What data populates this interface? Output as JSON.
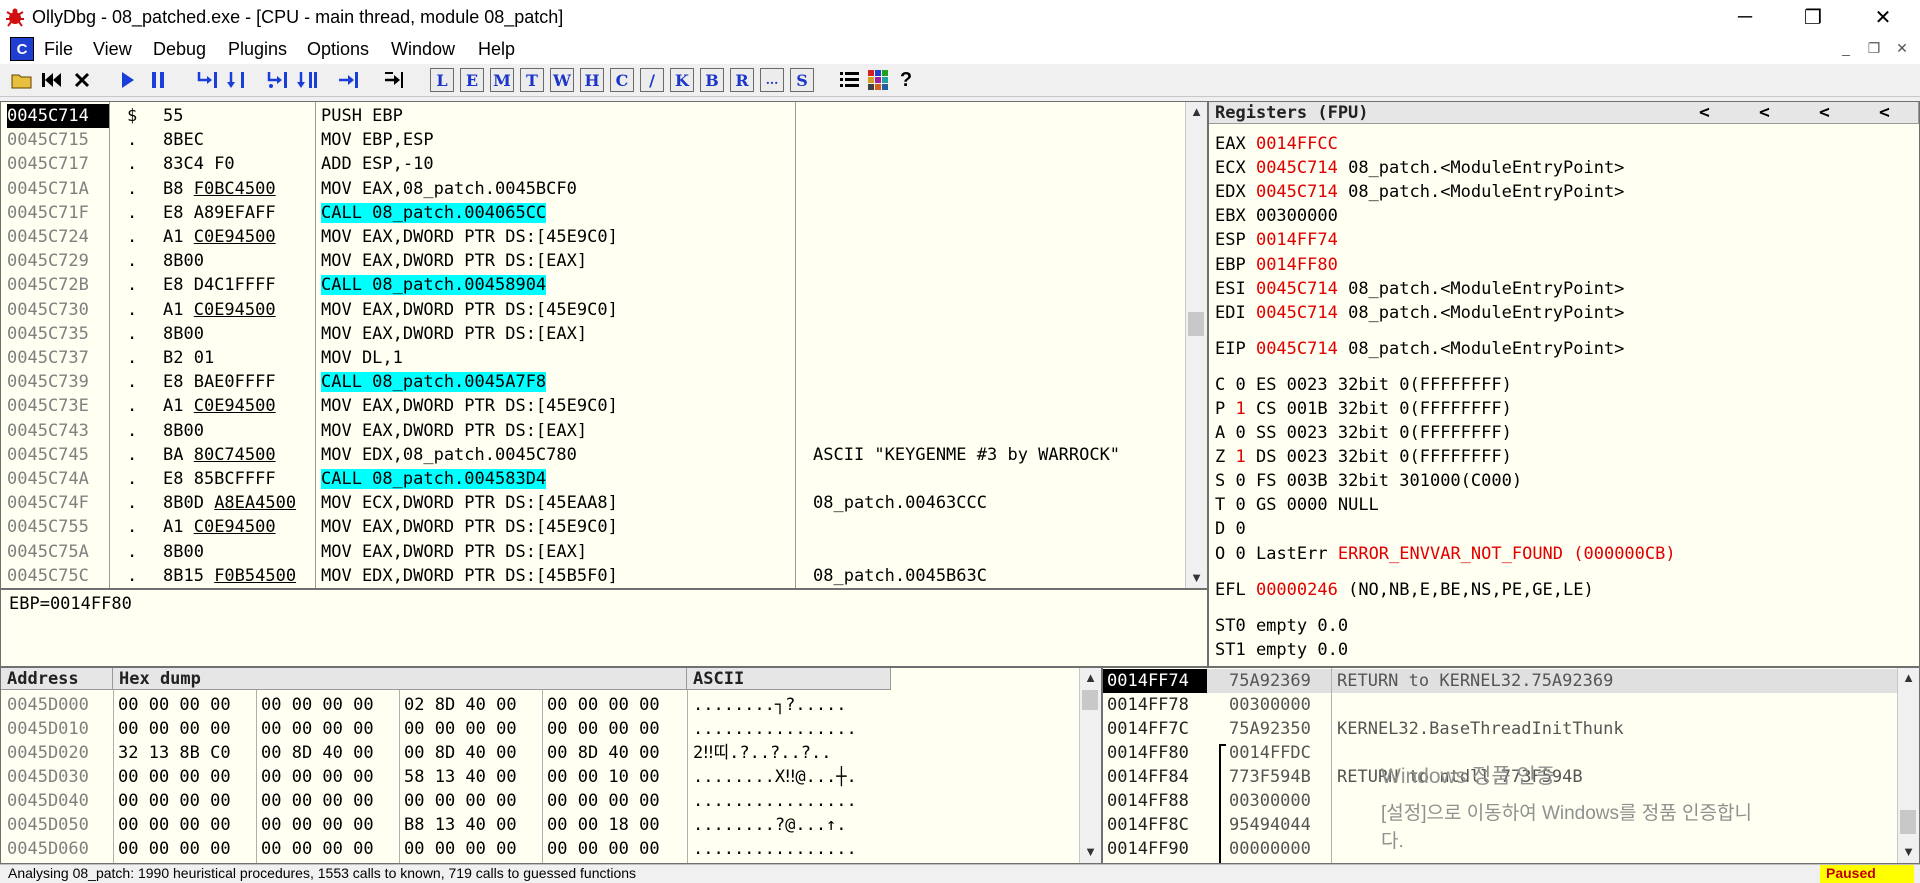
{
  "window": {
    "title": "OllyDbg - 08_patched.exe - [CPU - main thread, module 08_patch]",
    "controls": [
      "─",
      "❐",
      "✕"
    ]
  },
  "menu": {
    "icon_label": "C",
    "items": [
      "File",
      "View",
      "Debug",
      "Plugins",
      "Options",
      "Window",
      "Help"
    ],
    "mdi_controls": [
      "_",
      "❐",
      "✕"
    ]
  },
  "toolbar": {
    "letters": [
      "L",
      "E",
      "M",
      "T",
      "W",
      "H",
      "C",
      "/",
      "K",
      "B",
      "R",
      "...",
      "S"
    ]
  },
  "cpu": {
    "rows": [
      {
        "addr": "0045C714",
        "mark": "$",
        "hex": "55",
        "hex_ul": "",
        "dis": "PUSH EBP",
        "call": false,
        "comment": "",
        "selected": true
      },
      {
        "addr": "0045C715",
        "mark": ".",
        "hex": "8BEC",
        "hex_ul": "",
        "dis": "MOV EBP,ESP",
        "call": false,
        "comment": ""
      },
      {
        "addr": "0045C717",
        "mark": ".",
        "hex": "83C4 F0",
        "hex_ul": "",
        "dis": "ADD ESP,-10",
        "call": false,
        "comment": ""
      },
      {
        "addr": "0045C71A",
        "mark": ".",
        "hex": "B8 ",
        "hex_ul": "F0BC4500",
        "dis": "MOV EAX,08_patch.0045BCF0",
        "call": false,
        "comment": ""
      },
      {
        "addr": "0045C71F",
        "mark": ".",
        "hex": "E8 A89EFAFF",
        "hex_ul": "",
        "dis": "CALL 08_patch.004065CC",
        "call": true,
        "comment": ""
      },
      {
        "addr": "0045C724",
        "mark": ".",
        "hex": "A1 ",
        "hex_ul": "C0E94500",
        "dis": "MOV EAX,DWORD PTR DS:[45E9C0]",
        "call": false,
        "comment": ""
      },
      {
        "addr": "0045C729",
        "mark": ".",
        "hex": "8B00",
        "hex_ul": "",
        "dis": "MOV EAX,DWORD PTR DS:[EAX]",
        "call": false,
        "comment": ""
      },
      {
        "addr": "0045C72B",
        "mark": ".",
        "hex": "E8 D4C1FFFF",
        "hex_ul": "",
        "dis": "CALL 08_patch.00458904",
        "call": true,
        "comment": ""
      },
      {
        "addr": "0045C730",
        "mark": ".",
        "hex": "A1 ",
        "hex_ul": "C0E94500",
        "dis": "MOV EAX,DWORD PTR DS:[45E9C0]",
        "call": false,
        "comment": ""
      },
      {
        "addr": "0045C735",
        "mark": ".",
        "hex": "8B00",
        "hex_ul": "",
        "dis": "MOV EAX,DWORD PTR DS:[EAX]",
        "call": false,
        "comment": ""
      },
      {
        "addr": "0045C737",
        "mark": ".",
        "hex": "B2 01",
        "hex_ul": "",
        "dis": "MOV DL,1",
        "call": false,
        "comment": ""
      },
      {
        "addr": "0045C739",
        "mark": ".",
        "hex": "E8 BAE0FFFF",
        "hex_ul": "",
        "dis": "CALL 08_patch.0045A7F8",
        "call": true,
        "comment": ""
      },
      {
        "addr": "0045C73E",
        "mark": ".",
        "hex": "A1 ",
        "hex_ul": "C0E94500",
        "dis": "MOV EAX,DWORD PTR DS:[45E9C0]",
        "call": false,
        "comment": ""
      },
      {
        "addr": "0045C743",
        "mark": ".",
        "hex": "8B00",
        "hex_ul": "",
        "dis": "MOV EAX,DWORD PTR DS:[EAX]",
        "call": false,
        "comment": ""
      },
      {
        "addr": "0045C745",
        "mark": ".",
        "hex": "BA ",
        "hex_ul": "80C74500",
        "dis": "MOV EDX,08_patch.0045C780",
        "call": false,
        "comment": "ASCII \"KEYGENME #3 by WARROCK\""
      },
      {
        "addr": "0045C74A",
        "mark": ".",
        "hex": "E8 85BCFFFF",
        "hex_ul": "",
        "dis": "CALL 08_patch.004583D4",
        "call": true,
        "comment": ""
      },
      {
        "addr": "0045C74F",
        "mark": ".",
        "hex": "8B0D ",
        "hex_ul": "A8EA4500",
        "dis": "MOV ECX,DWORD PTR DS:[45EAA8]",
        "call": false,
        "comment": "08_patch.00463CCC"
      },
      {
        "addr": "0045C755",
        "mark": ".",
        "hex": "A1 ",
        "hex_ul": "C0E94500",
        "dis": "MOV EAX,DWORD PTR DS:[45E9C0]",
        "call": false,
        "comment": ""
      },
      {
        "addr": "0045C75A",
        "mark": ".",
        "hex": "8B00",
        "hex_ul": "",
        "dis": "MOV EAX,DWORD PTR DS:[EAX]",
        "call": false,
        "comment": ""
      },
      {
        "addr": "0045C75C",
        "mark": ".",
        "hex": "8B15 ",
        "hex_ul": "F0B54500",
        "dis": "MOV EDX,DWORD PTR DS:[45B5F0]",
        "call": false,
        "comment": "08_patch.0045B63C"
      }
    ],
    "info_line": "EBP=0014FF80"
  },
  "registers": {
    "header": "Registers (FPU)",
    "regs": [
      {
        "name": "EAX",
        "value": "0014FFCC",
        "comment": ""
      },
      {
        "name": "ECX",
        "value": "0045C714",
        "comment": "08_patch.<ModuleEntryPoint>"
      },
      {
        "name": "EDX",
        "value": "0045C714",
        "comment": "08_patch.<ModuleEntryPoint>"
      },
      {
        "name": "EBX",
        "value": "00300000",
        "comment": "",
        "black": true
      },
      {
        "name": "ESP",
        "value": "0014FF74",
        "comment": ""
      },
      {
        "name": "EBP",
        "value": "0014FF80",
        "comment": ""
      },
      {
        "name": "ESI",
        "value": "0045C714",
        "comment": "08_patch.<ModuleEntryPoint>"
      },
      {
        "name": "EDI",
        "value": "0045C714",
        "comment": "08_patch.<ModuleEntryPoint>"
      }
    ],
    "eip": {
      "name": "EIP",
      "value": "0045C714",
      "comment": "08_patch.<ModuleEntryPoint>"
    },
    "flags": [
      {
        "flag": "C",
        "val": "0",
        "seg": "ES",
        "sel": "0023",
        "desc": "32bit 0(FFFFFFFF)"
      },
      {
        "flag": "P",
        "val": "1",
        "seg": "CS",
        "sel": "001B",
        "desc": "32bit 0(FFFFFFFF)",
        "red": true
      },
      {
        "flag": "A",
        "val": "0",
        "seg": "SS",
        "sel": "0023",
        "desc": "32bit 0(FFFFFFFF)"
      },
      {
        "flag": "Z",
        "val": "1",
        "seg": "DS",
        "sel": "0023",
        "desc": "32bit 0(FFFFFFFF)",
        "red": true
      },
      {
        "flag": "S",
        "val": "0",
        "seg": "FS",
        "sel": "003B",
        "desc": "32bit 301000(C000)"
      },
      {
        "flag": "T",
        "val": "0",
        "seg": "GS",
        "sel": "0000",
        "desc": "NULL"
      },
      {
        "flag": "D",
        "val": "0",
        "seg": "",
        "sel": "",
        "desc": ""
      },
      {
        "flag": "O",
        "val": "0",
        "seg": "LastErr",
        "sel": "",
        "desc": "ERROR_ENVVAR_NOT_FOUND (000000CB)"
      }
    ],
    "efl": {
      "name": "EFL",
      "value": "00000246",
      "desc": "(NO,NB,E,BE,NS,PE,GE,LE)"
    },
    "fpu": [
      "ST0 empty 0.0",
      "ST1 empty 0.0"
    ]
  },
  "dump": {
    "headers": {
      "address": "Address",
      "hex": "Hex dump",
      "ascii": "ASCII"
    },
    "rows": [
      {
        "addr": "0045D000",
        "g1": "00 00 00 00",
        "g2": "00 00 00 00",
        "g3": "02 8D 40 00",
        "g4": "00 00 00 00",
        "ascii": "........┐?....."
      },
      {
        "addr": "0045D010",
        "g1": "00 00 00 00",
        "g2": "00 00 00 00",
        "g3": "00 00 00 00",
        "g4": "00 00 00 00",
        "ascii": "................"
      },
      {
        "addr": "0045D020",
        "g1": "32 13 8B C0",
        "g2": "00 8D 40 00",
        "g3": "00 8D 40 00",
        "g4": "00 8D 40 00",
        "ascii": "2‼띠.?..?..?.."
      },
      {
        "addr": "0045D030",
        "g1": "00 00 00 00",
        "g2": "00 00 00 00",
        "g3": "58 13 40 00",
        "g4": "00 00 10 00",
        "ascii": "........X‼@...┼."
      },
      {
        "addr": "0045D040",
        "g1": "00 00 00 00",
        "g2": "00 00 00 00",
        "g3": "00 00 00 00",
        "g4": "00 00 00 00",
        "ascii": "................"
      },
      {
        "addr": "0045D050",
        "g1": "00 00 00 00",
        "g2": "00 00 00 00",
        "g3": "B8 13 40 00",
        "g4": "00 00 18 00",
        "ascii": "........?@...↑."
      },
      {
        "addr": "0045D060",
        "g1": "00 00 00 00",
        "g2": "00 00 00 00",
        "g3": "00 00 00 00",
        "g4": "00 00 00 00",
        "ascii": "................"
      }
    ]
  },
  "stack": {
    "rows": [
      {
        "addr": "0014FF74",
        "value": "75A92369",
        "comment": "RETURN to KERNEL32.75A92369",
        "selected": true
      },
      {
        "addr": "0014FF78",
        "value": "00300000",
        "comment": ""
      },
      {
        "addr": "0014FF7C",
        "value": "75A92350",
        "comment": "KERNEL32.BaseThreadInitThunk"
      },
      {
        "addr": "0014FF80",
        "value": "0014FFDC",
        "comment": ""
      },
      {
        "addr": "0014FF84",
        "value": "773F594B",
        "comment": "RETURN to ntdll.773F594B"
      },
      {
        "addr": "0014FF88",
        "value": "00300000",
        "comment": ""
      },
      {
        "addr": "0014FF8C",
        "value": "95494044",
        "comment": ""
      },
      {
        "addr": "0014FF90",
        "value": "00000000",
        "comment": ""
      }
    ]
  },
  "watermark": {
    "line1": "Windows 정품 인증",
    "line2": "[설정]으로 이동하여 Windows를 정품 인증합니",
    "line3": "다."
  },
  "status": {
    "message": "Analysing 08_patch: 1990 heuristical procedures, 1553 calls to known, 719 calls to guessed functions",
    "state": "Paused"
  },
  "colors": {
    "pane_bg": "#fffff2",
    "call_highlight": "#00ffff",
    "register_changed": "#e00000",
    "status_paused_bg": "#ffff00"
  }
}
